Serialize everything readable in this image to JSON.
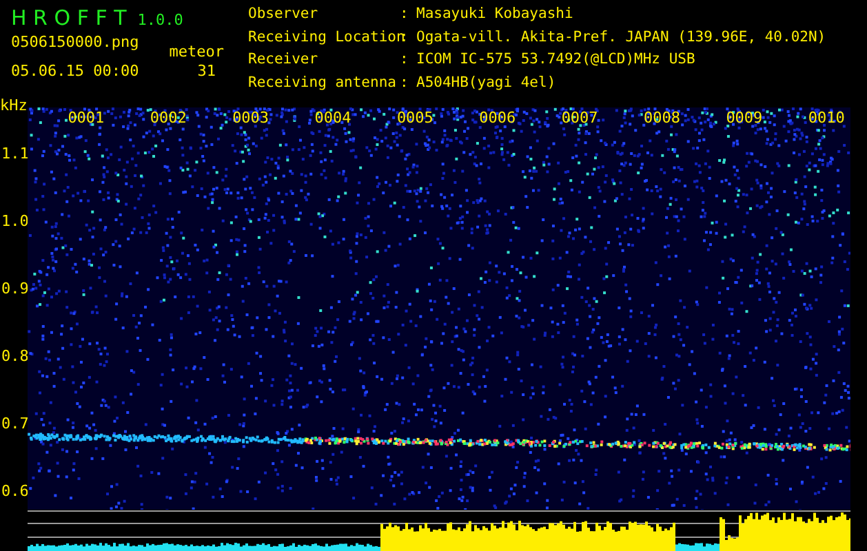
{
  "app": {
    "title": "H R O F F T",
    "version": "1.0.0"
  },
  "file": {
    "name": "0506150000.png",
    "datetime": "05.06.15 00:00"
  },
  "meteor": {
    "label": "meteor",
    "count": "31"
  },
  "info": [
    {
      "label": "Observer",
      "separator": ":",
      "value": "Masayuki Kobayashi"
    },
    {
      "label": "Receiving Location",
      "separator": ":",
      "value": "Ogata-vill. Akita-Pref. JAPAN (139.96E, 40.02N)"
    },
    {
      "label": "Receiver",
      "separator": ":",
      "value": "ICOM IC-575 53.7492(@LCD)MHz USB"
    },
    {
      "label": "Receiving antenna",
      "separator": ":",
      "value": "A504HB(yagi 4el)"
    }
  ],
  "spectrogram": {
    "unit": "kHz",
    "y_labels": [
      "1.1",
      "1.0",
      "0.9",
      "0.8",
      "0.7",
      "0.6"
    ],
    "minute_labels": [
      "0001",
      "0002",
      "0003",
      "0004",
      "0005",
      "0006",
      "0007",
      "0008",
      "0009",
      "0010"
    ]
  }
}
